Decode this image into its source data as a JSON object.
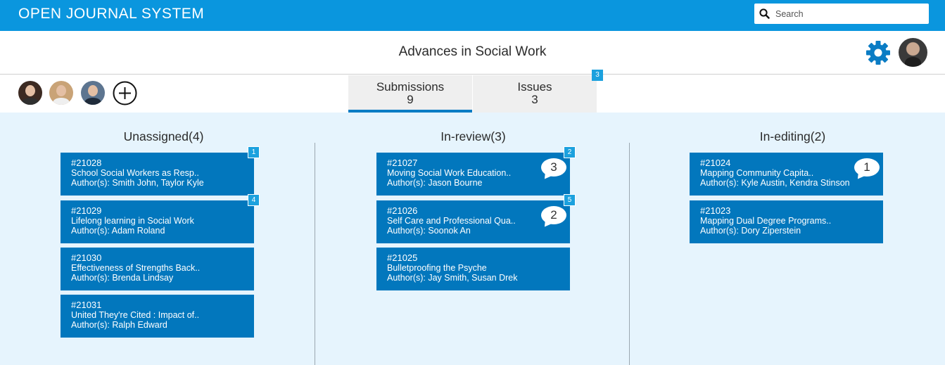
{
  "app": {
    "title": "OPEN JOURNAL SYSTEM"
  },
  "search": {
    "placeholder": "Search",
    "icon": "search-icon"
  },
  "journal": {
    "title": "Advances in Social Work"
  },
  "header_icons": {
    "settings": "gear-icon",
    "user": "user-avatar"
  },
  "team": {
    "add_icon": "plus-circle-icon"
  },
  "tabs": {
    "submissions": {
      "label": "Submissions",
      "count": "9"
    },
    "issues": {
      "label": "Issues",
      "count": "3",
      "badge": "3"
    }
  },
  "colors": {
    "topbar": "#0a96de",
    "card": "#0277bd",
    "board": "#e6f4fd",
    "badge": "#1ca1de",
    "gear": "#0a7cc4"
  },
  "columns": [
    {
      "title": "Unassigned(4)",
      "cards": [
        {
          "id": "#21028",
          "title": "School Social Workers as Resp..",
          "authors": "Author(s): Smith John, Taylor Kyle",
          "badge": "1",
          "comments": ""
        },
        {
          "id": "#21029",
          "title": "Lifelong learning in Social Work",
          "authors": "Author(s): Adam Roland",
          "badge": "4",
          "comments": ""
        },
        {
          "id": "#21030",
          "title": "Effectiveness of Strengths Back..",
          "authors": "Author(s): Brenda Lindsay",
          "badge": "",
          "comments": ""
        },
        {
          "id": "#21031",
          "title": "United They're Cited : Impact of..",
          "authors": "Author(s): Ralph Edward",
          "badge": "",
          "comments": ""
        }
      ]
    },
    {
      "title": "In-review(3)",
      "cards": [
        {
          "id": "#21027",
          "title": "Moving Social Work Education..",
          "authors": "Author(s): Jason Bourne",
          "badge": "2",
          "comments": "3"
        },
        {
          "id": "#21026",
          "title": "Self Care and Professional Qua..",
          "authors": "Author(s): Soonok An",
          "badge": "5",
          "comments": "2"
        },
        {
          "id": "#21025",
          "title": "Bulletproofing the Psyche",
          "authors": "Author(s): Jay Smith, Susan Drek",
          "badge": "",
          "comments": ""
        }
      ]
    },
    {
      "title": "In-editing(2)",
      "cards": [
        {
          "id": "#21024",
          "title": "Mapping Community Capita..",
          "authors": "Author(s): Kyle Austin, Kendra Stinson",
          "badge": "",
          "comments": "1"
        },
        {
          "id": "#21023",
          "title": "Mapping Dual Degree Programs..",
          "authors": "Author(s): Dory Ziperstein",
          "badge": "",
          "comments": ""
        }
      ]
    }
  ]
}
